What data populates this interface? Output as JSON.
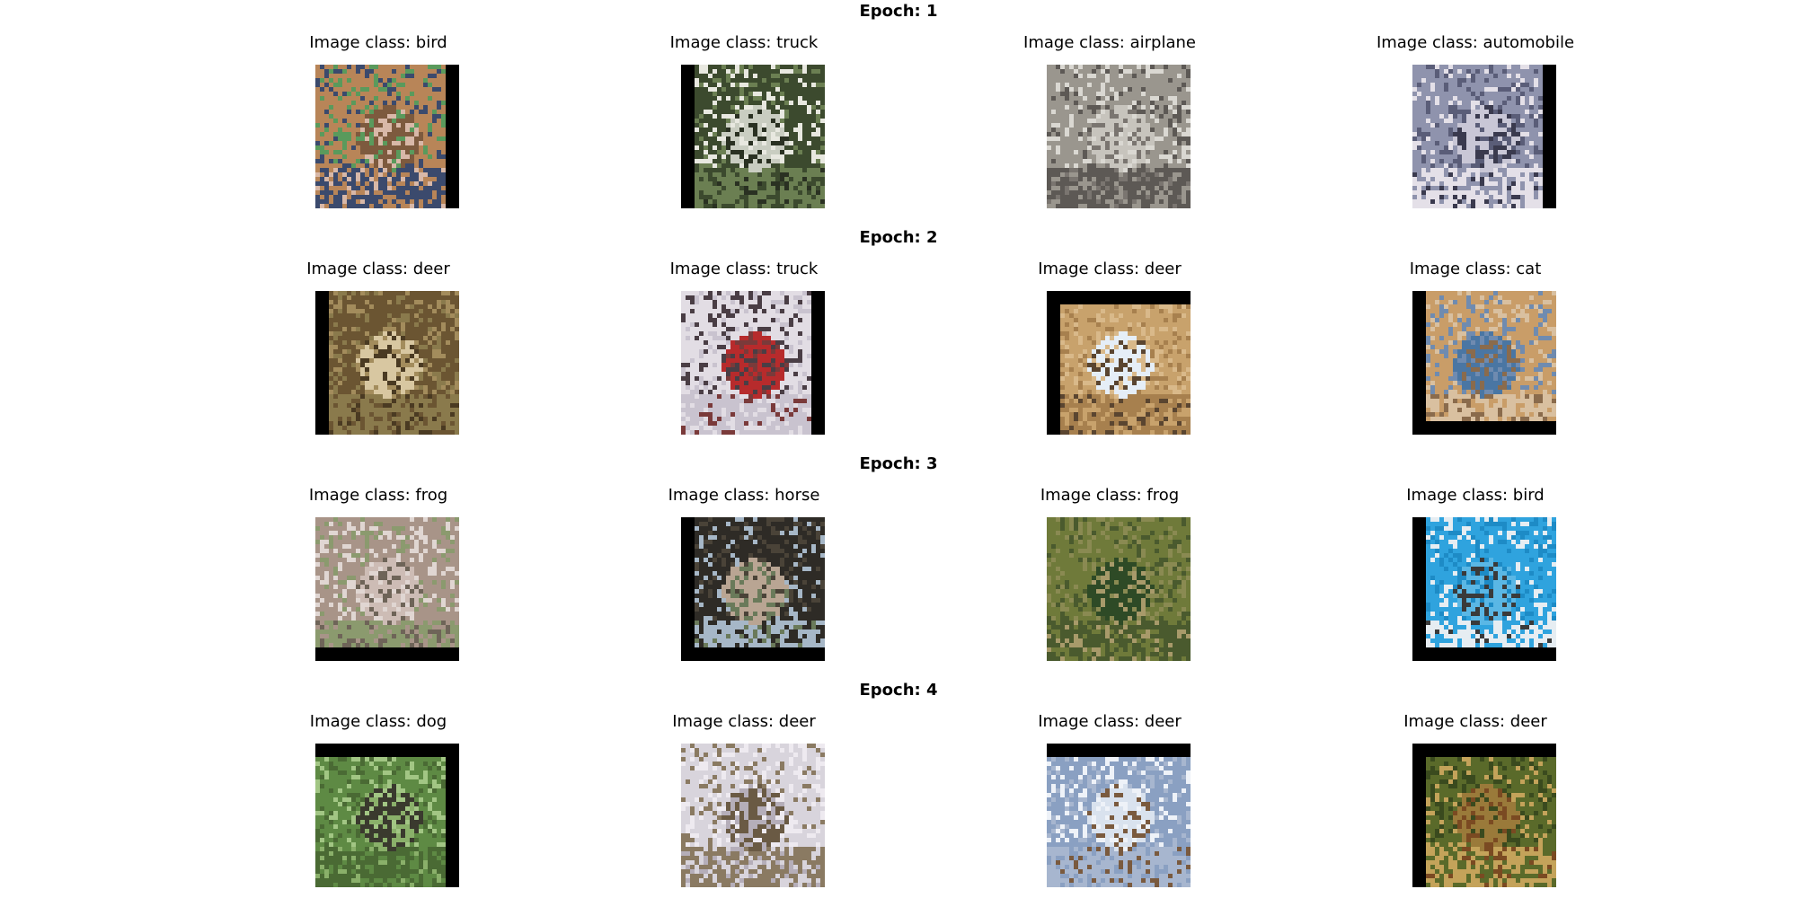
{
  "figure": {
    "epochs": [
      {
        "title": "Epoch: 1",
        "images": [
          {
            "label": "Image class: bird",
            "class": "bird",
            "colors": [
              "#b88558",
              "#7d5a3e",
              "#d8b8a8",
              "#3b4a6d",
              "#5a9a5c"
            ],
            "pad": "right"
          },
          {
            "label": "Image class: truck",
            "class": "truck",
            "colors": [
              "#3c4a2e",
              "#c9cdc1",
              "#2a3122",
              "#6b7f52",
              "#e8e8e0"
            ],
            "pad": "left"
          },
          {
            "label": "Image class: airplane",
            "class": "airplane",
            "colors": [
              "#9a968e",
              "#c7c4bd",
              "#7a7570",
              "#5d5955",
              "#dad8d2"
            ],
            "pad": "none"
          },
          {
            "label": "Image class: automobile",
            "class": "automobile",
            "colors": [
              "#8f93ad",
              "#c9c7d6",
              "#3a3a4e",
              "#e4e0e8",
              "#5a5d78"
            ],
            "pad": "right"
          }
        ]
      },
      {
        "title": "Epoch: 2",
        "images": [
          {
            "label": "Image class: deer",
            "class": "deer",
            "colors": [
              "#6b5532",
              "#d8c7a1",
              "#4a3a22",
              "#8a7a4c",
              "#a38c5c"
            ],
            "pad": "left"
          },
          {
            "label": "Image class: truck",
            "class": "truck",
            "colors": [
              "#e2dde4",
              "#b72b2c",
              "#7a3a3a",
              "#c9c3cf",
              "#4a3e45"
            ],
            "pad": "right"
          },
          {
            "label": "Image class: deer",
            "class": "deer",
            "colors": [
              "#c8a26c",
              "#e5eef7",
              "#5a4530",
              "#a7804e",
              "#d9b98a"
            ],
            "pad": "topleft"
          },
          {
            "label": "Image class: cat",
            "class": "cat",
            "colors": [
              "#c99d68",
              "#4a76a3",
              "#8a6b4c",
              "#d9c0a0",
              "#6f8bb0"
            ],
            "pad": "bottomleft"
          }
        ]
      },
      {
        "title": "Epoch: 3",
        "images": [
          {
            "label": "Image class: frog",
            "class": "frog",
            "colors": [
              "#a89488",
              "#cdbcb5",
              "#6e6458",
              "#8b9a6e",
              "#e0d6d2"
            ],
            "pad": "bottom"
          },
          {
            "label": "Image class: horse",
            "class": "horse",
            "colors": [
              "#2e2b26",
              "#b9a593",
              "#6a7a5a",
              "#a6b7c7",
              "#4a4338"
            ],
            "pad": "bottomleft"
          },
          {
            "label": "Image class: frog",
            "class": "frog",
            "colors": [
              "#6f7a3a",
              "#2e4a26",
              "#a89a6a",
              "#4a5a2e",
              "#8a8a52"
            ],
            "pad": "none"
          },
          {
            "label": "Image class: bird",
            "class": "bird",
            "colors": [
              "#2fa3de",
              "#5ab7e5",
              "#3a3a3a",
              "#e6edf2",
              "#1d8bc6"
            ],
            "pad": "bottomleft"
          }
        ]
      },
      {
        "title": "Epoch: 4",
        "images": [
          {
            "label": "Image class: dog",
            "class": "dog",
            "colors": [
              "#5e8a44",
              "#3a3a2e",
              "#8ab06a",
              "#4a6a34",
              "#a2c684"
            ],
            "pad": "topright"
          },
          {
            "label": "Image class: deer",
            "class": "deer",
            "colors": [
              "#d8d4dc",
              "#6a5a44",
              "#b5aeb9",
              "#8a7a62",
              "#eeeaf0"
            ],
            "pad": "none"
          },
          {
            "label": "Image class: deer",
            "class": "deer",
            "colors": [
              "#8aa0c2",
              "#d9e2ee",
              "#7a5a3e",
              "#a7b6cf",
              "#eef2f8"
            ],
            "pad": "top"
          },
          {
            "label": "Image class: deer",
            "class": "deer",
            "colors": [
              "#5a6a2a",
              "#9a7a3a",
              "#7a4a22",
              "#c4a35a",
              "#3a4a1e"
            ],
            "pad": "topleft"
          }
        ]
      }
    ]
  }
}
